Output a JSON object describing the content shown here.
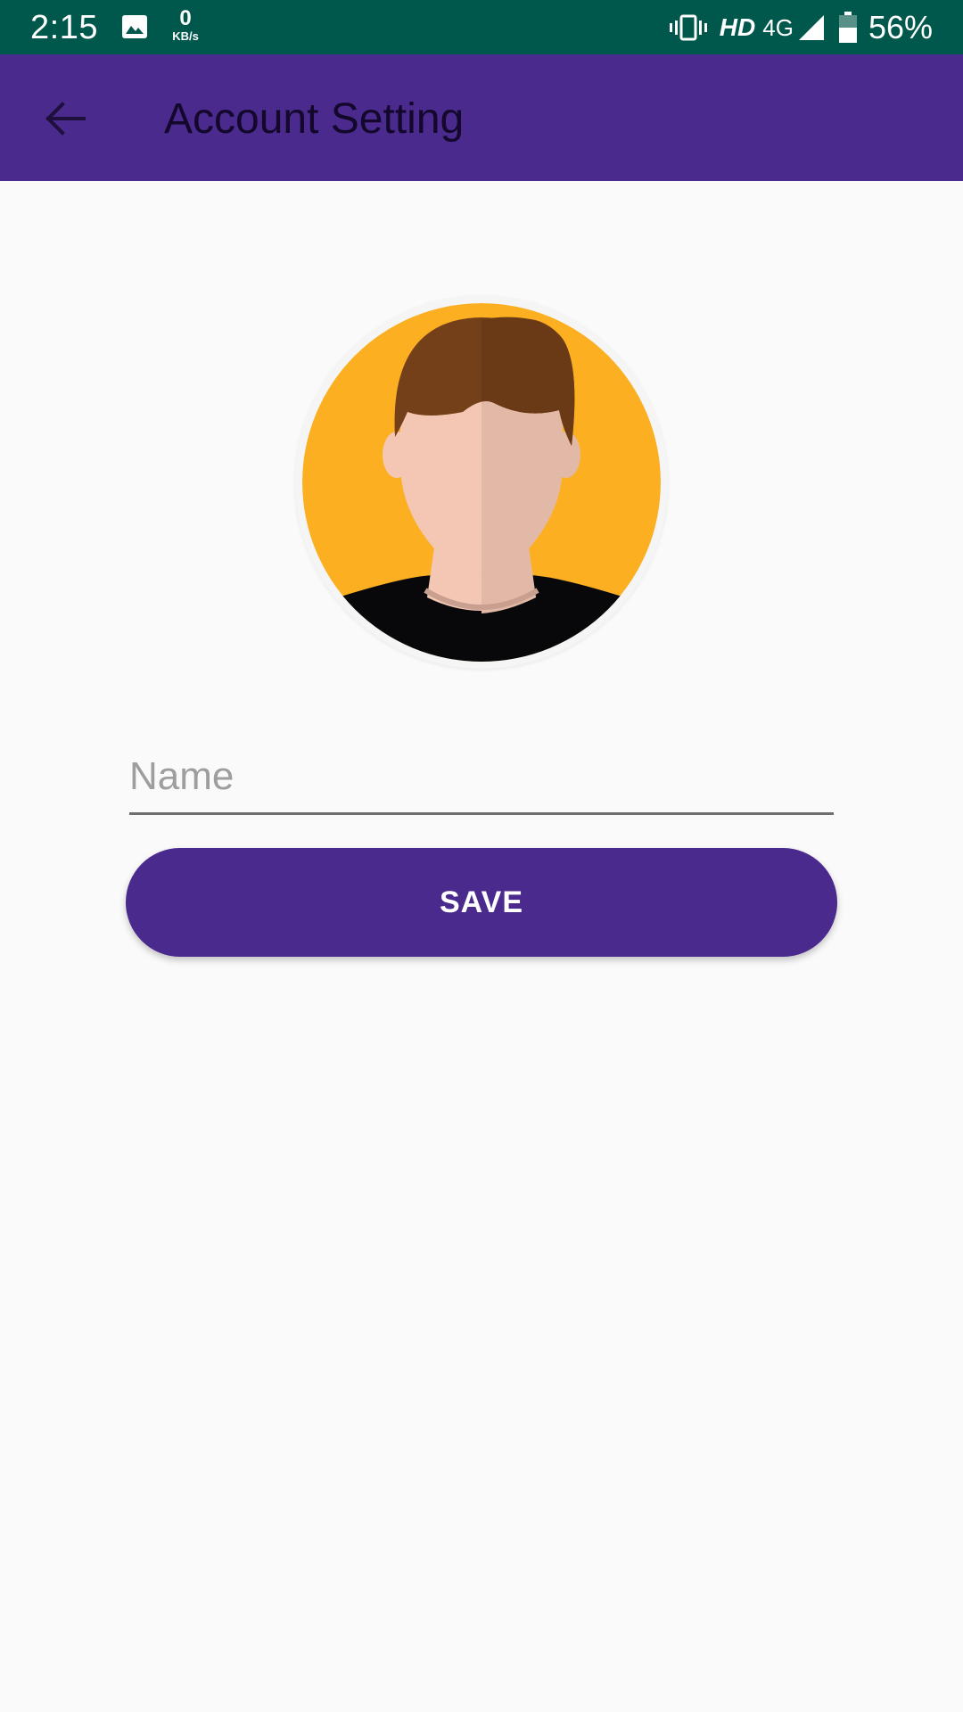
{
  "status_bar": {
    "time": "2:15",
    "net_speed_value": "0",
    "net_speed_unit": "KB/s",
    "hd_label": "HD",
    "network_type": "4G",
    "battery_percent": "56%",
    "icons": [
      "gallery-icon",
      "vibrate-icon",
      "signal-icon",
      "battery-icon"
    ]
  },
  "app_bar": {
    "title": "Account Setting",
    "back_icon": "arrow-back-icon"
  },
  "profile": {
    "avatar": "avatar-illustration"
  },
  "form": {
    "name_placeholder": "Name",
    "name_value": ""
  },
  "actions": {
    "save_label": "SAVE"
  },
  "colors": {
    "status_bar": "#00574b",
    "primary": "#4a2a8c",
    "background": "#fafafa",
    "avatar_bg": "#fbaf21"
  }
}
